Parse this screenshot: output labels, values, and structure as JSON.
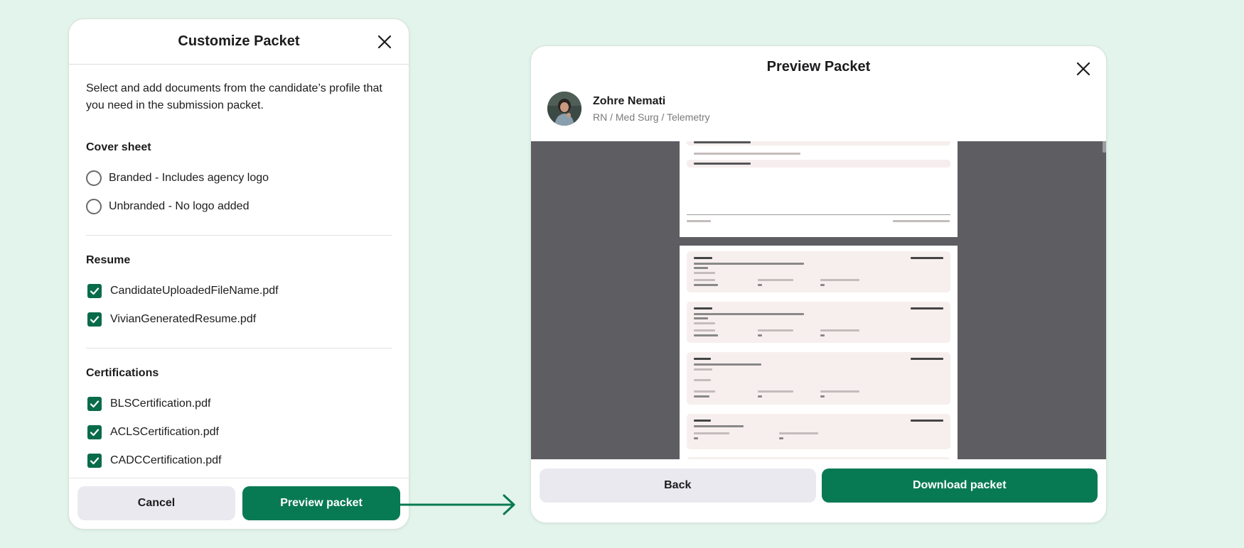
{
  "customize": {
    "title": "Customize Packet",
    "intro": "Select and add documents from the candidate’s profile that you need in the submission packet.",
    "cover_sheet": {
      "title": "Cover sheet",
      "options": [
        "Branded - Includes agency logo",
        "Unbranded - No logo added"
      ]
    },
    "resume": {
      "title": "Resume",
      "files": [
        "CandidateUploadedFileName.pdf",
        "VivianGeneratedResume.pdf"
      ]
    },
    "certifications": {
      "title": "Certifications",
      "files": [
        "BLSCertification.pdf",
        "ACLSCertification.pdf",
        "CADCCertification.pdf"
      ]
    },
    "cancel_label": "Cancel",
    "preview_label": "Preview packet"
  },
  "preview": {
    "title": "Preview Packet",
    "candidate": {
      "name": "Zohre Nemati",
      "role": "RN / Med Surg / Telemetry"
    },
    "back_label": "Back",
    "download_label": "Download packet"
  },
  "colors": {
    "background": "#e3f4ec",
    "primary": "#087a53",
    "secondary": "#ebe9f0",
    "viewer_bg": "#5e5d62"
  },
  "icons": {
    "close": "close-icon",
    "check": "check-icon",
    "arrow": "arrow-right-icon"
  }
}
